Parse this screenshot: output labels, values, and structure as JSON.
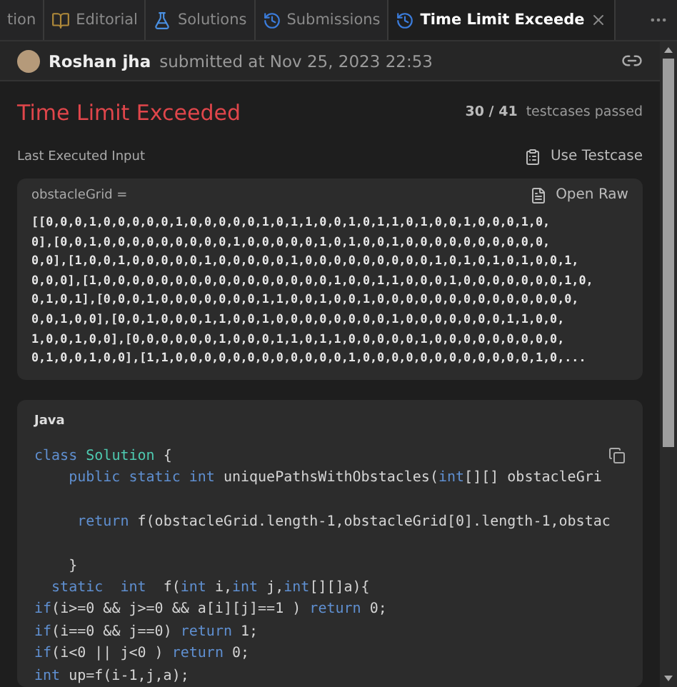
{
  "tabs": [
    {
      "label": "tion",
      "kind": "plain",
      "selected": false
    },
    {
      "label": "Editorial",
      "kind": "book",
      "selected": false
    },
    {
      "label": "Solutions",
      "kind": "flask",
      "selected": false
    },
    {
      "label": "Submissions",
      "kind": "history",
      "selected": false
    },
    {
      "label": "Time Limit Exceede",
      "kind": "history",
      "selected": true
    }
  ],
  "submission": {
    "user_name": "Roshan jha",
    "submitted_text": "submitted at Nov 25, 2023 22:53"
  },
  "result": {
    "status": "Time Limit Exceeded",
    "passed": "30 / 41",
    "passed_label": "testcases passed"
  },
  "last_input": {
    "label": "Last Executed Input",
    "use_button": "Use Testcase",
    "variable": "obstacleGrid =",
    "open_raw": "Open Raw",
    "lines": [
      "[[0,0,0,1,0,0,0,0,0,1,0,0,0,0,0,1,0,1,1,0,0,1,0,1,1,0,1,0,0,1,0,0,0,1,0,",
      "0],[0,0,1,0,0,0,0,0,0,0,0,0,1,0,0,0,0,0,1,0,1,0,0,1,0,0,0,0,0,0,0,0,0,0,",
      "0,0],[1,0,0,1,0,0,0,0,0,1,0,0,0,0,0,1,0,0,0,0,0,0,0,0,0,1,0,1,0,1,0,1,0,0,1,",
      "0,0,0],[1,0,0,0,0,0,0,0,0,0,0,0,0,0,0,0,0,1,0,0,1,1,0,0,0,1,0,0,0,0,0,0,0,1,0,",
      "0,1,0,1],[0,0,0,1,0,0,0,0,0,0,0,1,1,0,0,1,0,0,1,0,0,0,0,0,0,0,0,0,0,0,0,0,0,",
      "0,0,1,0,0],[0,0,1,0,0,0,1,1,0,0,1,0,0,0,0,0,0,0,0,1,0,0,0,0,0,0,0,1,1,0,0,",
      "1,0,0,1,0,0],[0,0,0,0,0,0,1,0,0,0,1,1,0,1,1,0,0,0,0,0,1,0,0,0,0,0,0,0,0,0,",
      "0,1,0,0,1,0,0],[1,1,0,0,0,0,0,0,0,0,0,0,0,0,1,0,0,0,0,0,0,0,0,0,0,0,0,1,0,..."
    ]
  },
  "code": {
    "language": "Java",
    "lines": [
      {
        "kind": "code",
        "tokens": [
          {
            "text": "class",
            "kind": "keyword"
          },
          {
            "text": " Solution",
            "kind": "type"
          },
          {
            "text": " {",
            "kind": "plain"
          }
        ]
      },
      {
        "kind": "code",
        "tokens": [
          {
            "text": "    public static int",
            "kind": "keyword"
          },
          {
            "text": " uniquePathsWithObstacles(",
            "kind": "plain"
          },
          {
            "text": "int",
            "kind": "keyword"
          },
          {
            "text": "[][] obstacleGri",
            "kind": "plain"
          }
        ]
      },
      {
        "kind": "blank"
      },
      {
        "kind": "code",
        "tokens": [
          {
            "text": "     return",
            "kind": "keyword"
          },
          {
            "text": " f(obstacleGrid.length-1,obstacleGrid[0].length-1,obstac",
            "kind": "plain"
          }
        ]
      },
      {
        "kind": "blank"
      },
      {
        "kind": "code",
        "tokens": [
          {
            "text": "    }",
            "kind": "plain"
          }
        ]
      },
      {
        "kind": "code",
        "tokens": [
          {
            "text": "  static  int",
            "kind": "keyword"
          },
          {
            "text": "  f(",
            "kind": "plain"
          },
          {
            "text": "int",
            "kind": "keyword"
          },
          {
            "text": " i,",
            "kind": "plain"
          },
          {
            "text": "int",
            "kind": "keyword"
          },
          {
            "text": " j,",
            "kind": "plain"
          },
          {
            "text": "int",
            "kind": "keyword"
          },
          {
            "text": "[][]a){",
            "kind": "plain"
          }
        ]
      },
      {
        "kind": "code",
        "tokens": [
          {
            "text": "if",
            "kind": "keyword"
          },
          {
            "text": "(i>=0 && j>=0 && a[i][j]==1 ) ",
            "kind": "plain"
          },
          {
            "text": "return",
            "kind": "keyword"
          },
          {
            "text": " 0;",
            "kind": "plain"
          }
        ]
      },
      {
        "kind": "code",
        "tokens": [
          {
            "text": "if",
            "kind": "keyword"
          },
          {
            "text": "(i==0 && j==0) ",
            "kind": "plain"
          },
          {
            "text": "return",
            "kind": "keyword"
          },
          {
            "text": " 1;",
            "kind": "plain"
          }
        ]
      },
      {
        "kind": "code",
        "tokens": [
          {
            "text": "if",
            "kind": "keyword"
          },
          {
            "text": "(i<0 || j<0 ) ",
            "kind": "plain"
          },
          {
            "text": "return",
            "kind": "keyword"
          },
          {
            "text": " 0;",
            "kind": "plain"
          }
        ]
      },
      {
        "kind": "code",
        "tokens": [
          {
            "text": "int",
            "kind": "keyword"
          },
          {
            "text": " up=f(i-1,j,a);",
            "kind": "plain"
          }
        ]
      }
    ]
  }
}
